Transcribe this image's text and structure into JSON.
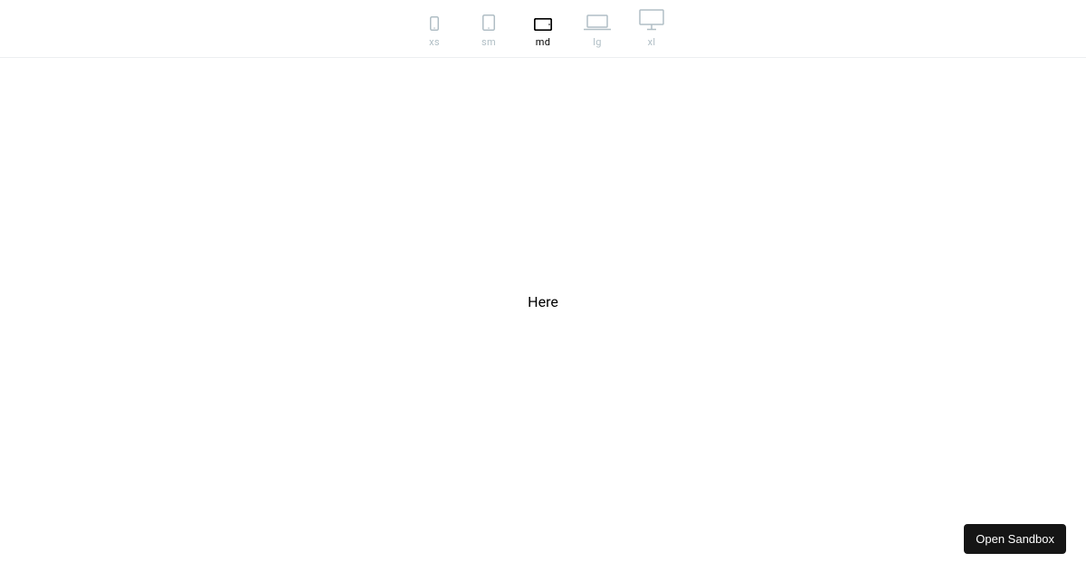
{
  "toolbar": {
    "breakpoints": [
      {
        "label": "xs",
        "active": false
      },
      {
        "label": "sm",
        "active": false
      },
      {
        "label": "md",
        "active": true
      },
      {
        "label": "lg",
        "active": false
      },
      {
        "label": "xl",
        "active": false
      }
    ]
  },
  "content": {
    "text": "Here"
  },
  "footer": {
    "open_sandbox_label": "Open Sandbox"
  }
}
